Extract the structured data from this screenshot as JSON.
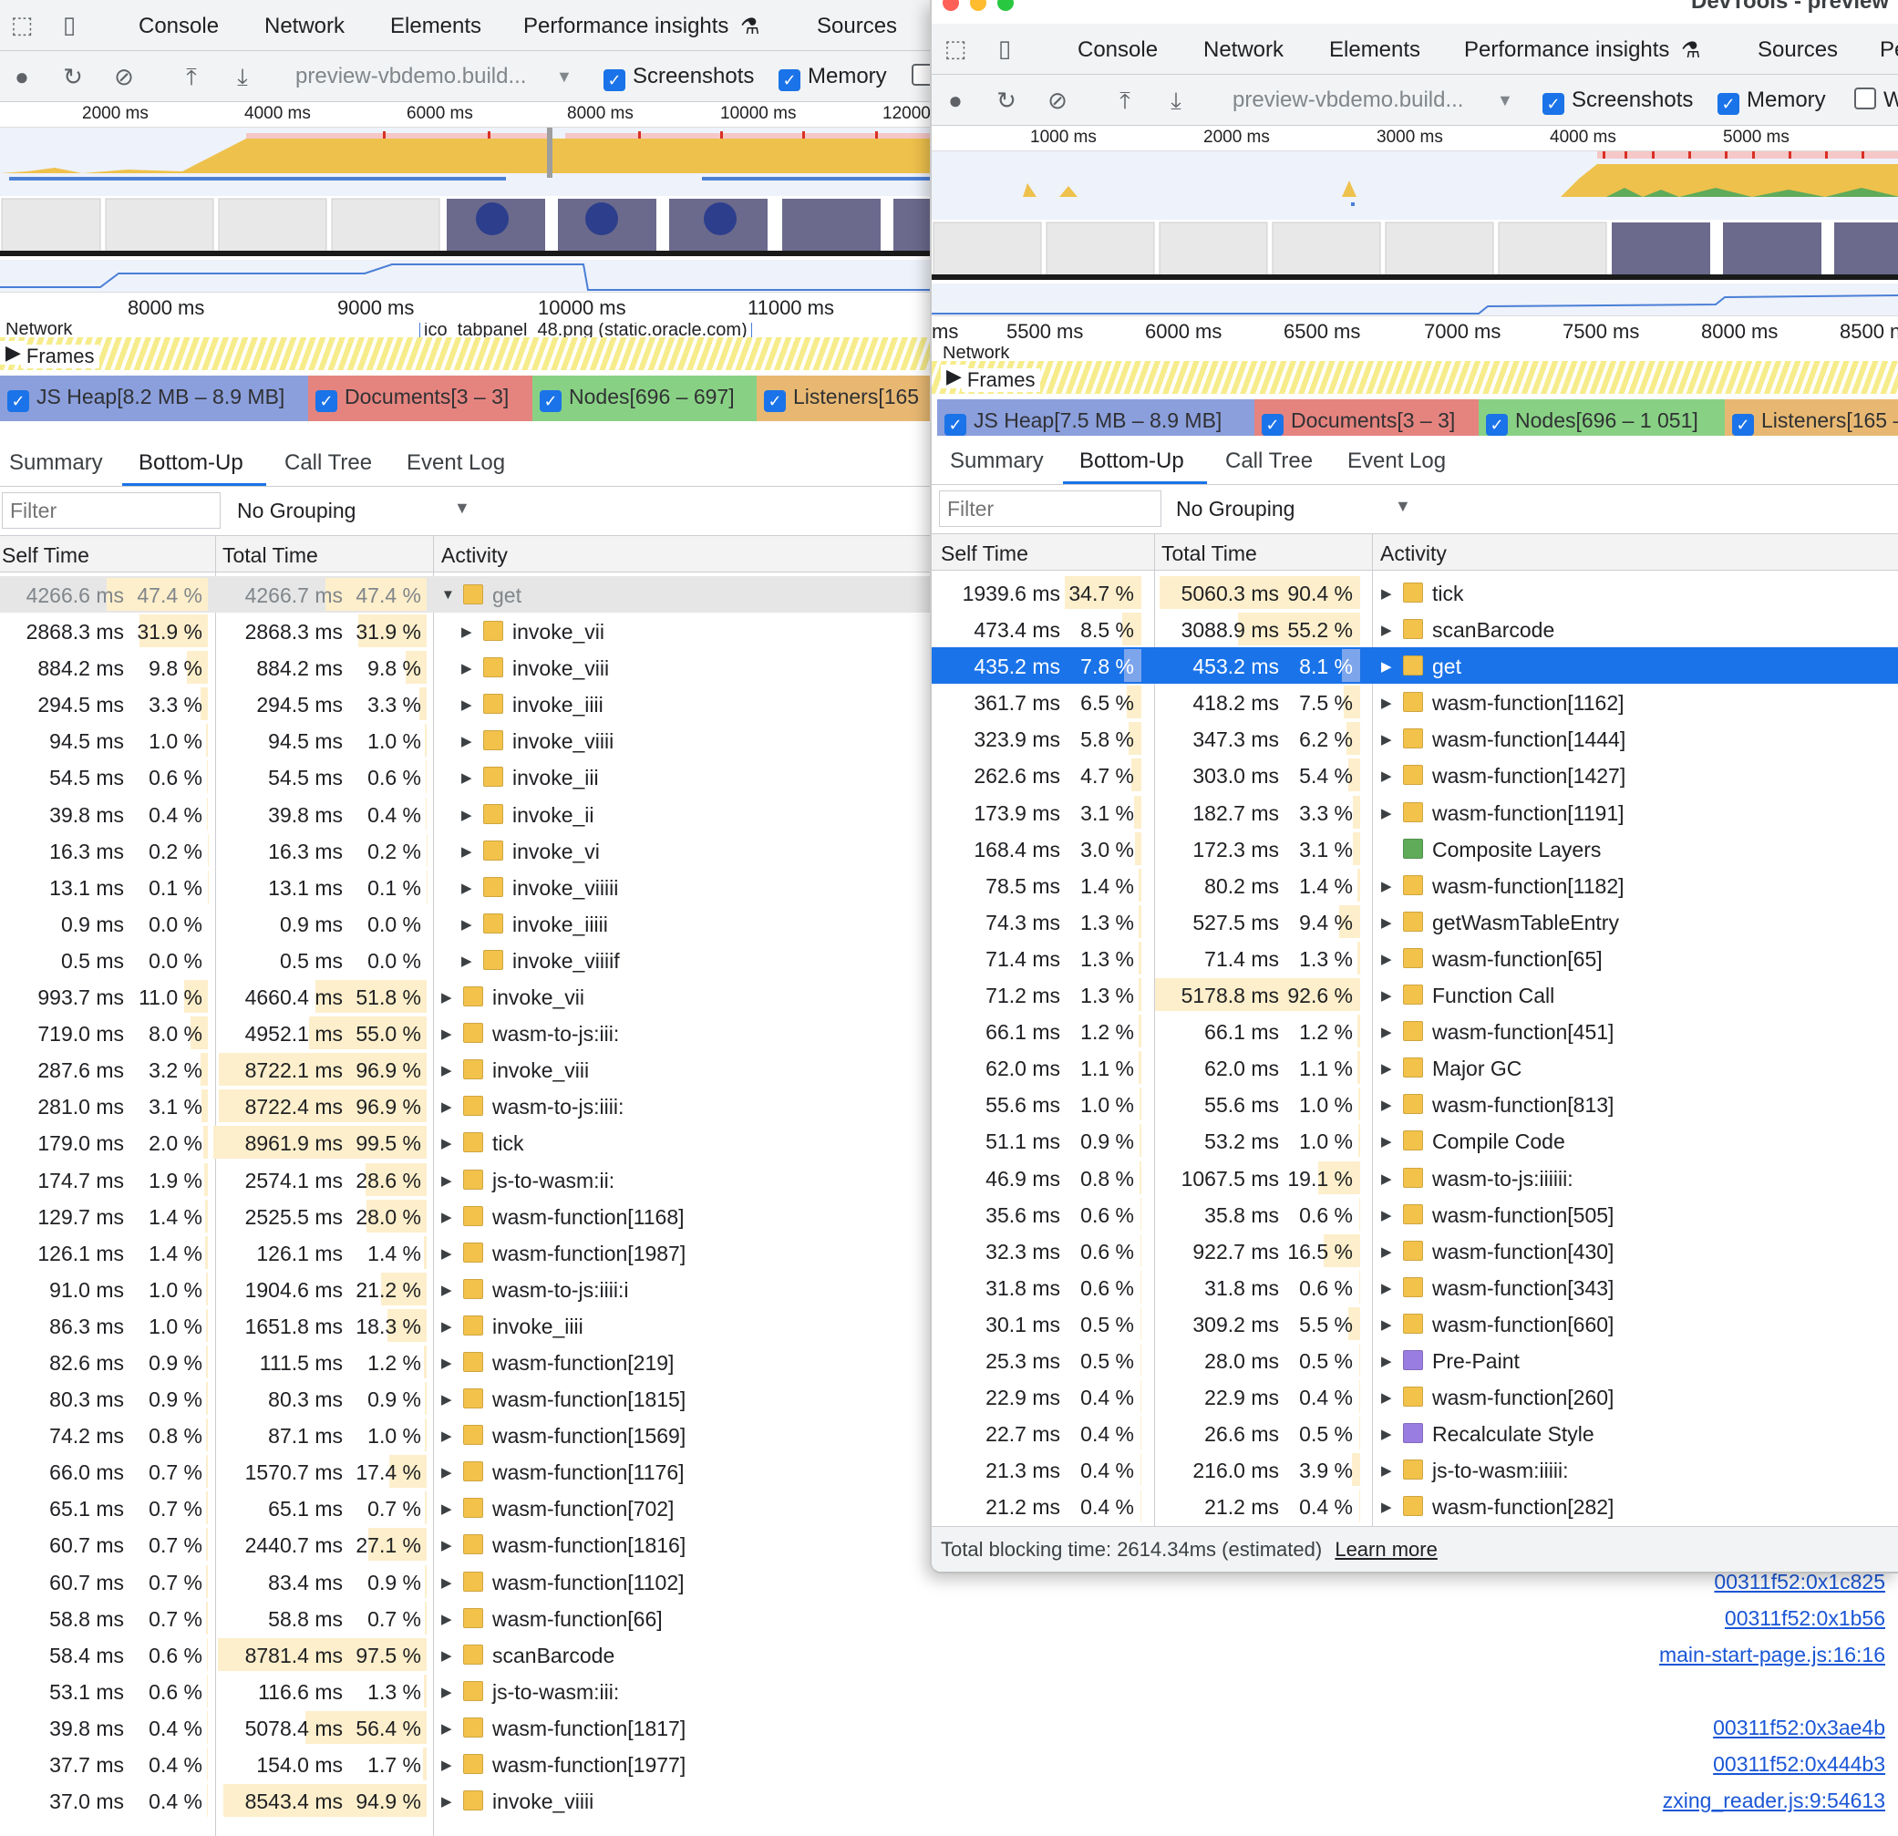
{
  "colors": {
    "accent": "#1a73e8",
    "bar": "#fdefcb",
    "js": "#f2c24b",
    "render": "#9a7de0",
    "paint": "#5fab5a"
  },
  "left": {
    "tabs": [
      "Console",
      "Network",
      "Elements",
      "Performance insights",
      "Sources"
    ],
    "toolbar": {
      "url": "preview-vbdemo.build...",
      "screenshots": "Screenshots",
      "memory": "Memory"
    },
    "ruler": [
      "2000 ms",
      "4000 ms",
      "6000 ms",
      "8000 ms",
      "10000 ms",
      "12000"
    ],
    "ruler2": [
      "8000 ms",
      "9000 ms",
      "10000 ms",
      "11000 ms"
    ],
    "network_label": "Network",
    "network_item": "ico_tabpanel_48.png (static.oracle.com)",
    "frames_label": "Frames",
    "counters": [
      "JS Heap[8.2 MB – 8.9 MB]",
      "Documents[3 – 3]",
      "Nodes[696 – 697]",
      "Listeners[165"
    ],
    "panel_tabs": [
      "Summary",
      "Bottom-Up",
      "Call Tree",
      "Event Log"
    ],
    "filter_placeholder": "Filter",
    "grouping": "No Grouping",
    "headers": {
      "self": "Self Time",
      "total": "Total Time",
      "activity": "Activity"
    },
    "rows": [
      {
        "self": "4266.6 ms",
        "selfp": "47.4 %",
        "sp": 47.4,
        "total": "4266.7 ms",
        "totalp": "47.4 %",
        "tp": 47.4,
        "name": "get",
        "depth": 0,
        "exp": "open",
        "color": "js",
        "hl": true
      },
      {
        "self": "2868.3 ms",
        "selfp": "31.9 %",
        "sp": 31.9,
        "total": "2868.3 ms",
        "totalp": "31.9 %",
        "tp": 31.9,
        "name": "invoke_vii",
        "depth": 1,
        "exp": "closed",
        "color": "js"
      },
      {
        "self": "884.2 ms",
        "selfp": "9.8 %",
        "sp": 9.8,
        "total": "884.2 ms",
        "totalp": "9.8 %",
        "tp": 9.8,
        "name": "invoke_viii",
        "depth": 1,
        "exp": "closed",
        "color": "js"
      },
      {
        "self": "294.5 ms",
        "selfp": "3.3 %",
        "sp": 3.3,
        "total": "294.5 ms",
        "totalp": "3.3 %",
        "tp": 3.3,
        "name": "invoke_iiii",
        "depth": 1,
        "exp": "closed",
        "color": "js"
      },
      {
        "self": "94.5 ms",
        "selfp": "1.0 %",
        "sp": 1.0,
        "total": "94.5 ms",
        "totalp": "1.0 %",
        "tp": 1.0,
        "name": "invoke_viiii",
        "depth": 1,
        "exp": "closed",
        "color": "js"
      },
      {
        "self": "54.5 ms",
        "selfp": "0.6 %",
        "sp": 0.6,
        "total": "54.5 ms",
        "totalp": "0.6 %",
        "tp": 0.6,
        "name": "invoke_iii",
        "depth": 1,
        "exp": "closed",
        "color": "js"
      },
      {
        "self": "39.8 ms",
        "selfp": "0.4 %",
        "sp": 0.4,
        "total": "39.8 ms",
        "totalp": "0.4 %",
        "tp": 0.4,
        "name": "invoke_ii",
        "depth": 1,
        "exp": "closed",
        "color": "js"
      },
      {
        "self": "16.3 ms",
        "selfp": "0.2 %",
        "sp": 0.2,
        "total": "16.3 ms",
        "totalp": "0.2 %",
        "tp": 0.2,
        "name": "invoke_vi",
        "depth": 1,
        "exp": "closed",
        "color": "js"
      },
      {
        "self": "13.1 ms",
        "selfp": "0.1 %",
        "sp": 0.1,
        "total": "13.1 ms",
        "totalp": "0.1 %",
        "tp": 0.1,
        "name": "invoke_viiiii",
        "depth": 1,
        "exp": "closed",
        "color": "js"
      },
      {
        "self": "0.9 ms",
        "selfp": "0.0 %",
        "sp": 0,
        "total": "0.9 ms",
        "totalp": "0.0 %",
        "tp": 0,
        "name": "invoke_iiiii",
        "depth": 1,
        "exp": "closed",
        "color": "js"
      },
      {
        "self": "0.5 ms",
        "selfp": "0.0 %",
        "sp": 0,
        "total": "0.5 ms",
        "totalp": "0.0 %",
        "tp": 0,
        "name": "invoke_viiiif",
        "depth": 1,
        "exp": "closed",
        "color": "js"
      },
      {
        "self": "993.7 ms",
        "selfp": "11.0 %",
        "sp": 11.0,
        "total": "4660.4 ms",
        "totalp": "51.8 %",
        "tp": 51.8,
        "name": "invoke_vii",
        "depth": 0,
        "exp": "closed",
        "color": "js"
      },
      {
        "self": "719.0 ms",
        "selfp": "8.0 %",
        "sp": 8.0,
        "total": "4952.1 ms",
        "totalp": "55.0 %",
        "tp": 55.0,
        "name": "wasm-to-js:iii:",
        "depth": 0,
        "exp": "closed",
        "color": "js"
      },
      {
        "self": "287.6 ms",
        "selfp": "3.2 %",
        "sp": 3.2,
        "total": "8722.1 ms",
        "totalp": "96.9 %",
        "tp": 96.9,
        "name": "invoke_viii",
        "depth": 0,
        "exp": "closed",
        "color": "js"
      },
      {
        "self": "281.0 ms",
        "selfp": "3.1 %",
        "sp": 3.1,
        "total": "8722.4 ms",
        "totalp": "96.9 %",
        "tp": 96.9,
        "name": "wasm-to-js:iiii:",
        "depth": 0,
        "exp": "closed",
        "color": "js"
      },
      {
        "self": "179.0 ms",
        "selfp": "2.0 %",
        "sp": 2.0,
        "total": "8961.9 ms",
        "totalp": "99.5 %",
        "tp": 99.5,
        "name": "tick",
        "depth": 0,
        "exp": "closed",
        "color": "js"
      },
      {
        "self": "174.7 ms",
        "selfp": "1.9 %",
        "sp": 1.9,
        "total": "2574.1 ms",
        "totalp": "28.6 %",
        "tp": 28.6,
        "name": "js-to-wasm:ii:",
        "depth": 0,
        "exp": "closed",
        "color": "js"
      },
      {
        "self": "129.7 ms",
        "selfp": "1.4 %",
        "sp": 1.4,
        "total": "2525.5 ms",
        "totalp": "28.0 %",
        "tp": 28.0,
        "name": "wasm-function[1168]",
        "depth": 0,
        "exp": "closed",
        "color": "js"
      },
      {
        "self": "126.1 ms",
        "selfp": "1.4 %",
        "sp": 1.4,
        "total": "126.1 ms",
        "totalp": "1.4 %",
        "tp": 1.4,
        "name": "wasm-function[1987]",
        "depth": 0,
        "exp": "closed",
        "color": "js"
      },
      {
        "self": "91.0 ms",
        "selfp": "1.0 %",
        "sp": 1.0,
        "total": "1904.6 ms",
        "totalp": "21.2 %",
        "tp": 21.2,
        "name": "wasm-to-js:iiii:i",
        "depth": 0,
        "exp": "closed",
        "color": "js"
      },
      {
        "self": "86.3 ms",
        "selfp": "1.0 %",
        "sp": 1.0,
        "total": "1651.8 ms",
        "totalp": "18.3 %",
        "tp": 18.3,
        "name": "invoke_iiii",
        "depth": 0,
        "exp": "closed",
        "color": "js"
      },
      {
        "self": "82.6 ms",
        "selfp": "0.9 %",
        "sp": 0.9,
        "total": "111.5 ms",
        "totalp": "1.2 %",
        "tp": 1.2,
        "name": "wasm-function[219]",
        "depth": 0,
        "exp": "closed",
        "color": "js"
      },
      {
        "self": "80.3 ms",
        "selfp": "0.9 %",
        "sp": 0.9,
        "total": "80.3 ms",
        "totalp": "0.9 %",
        "tp": 0.9,
        "name": "wasm-function[1815]",
        "depth": 0,
        "exp": "closed",
        "color": "js"
      },
      {
        "self": "74.2 ms",
        "selfp": "0.8 %",
        "sp": 0.8,
        "total": "87.1 ms",
        "totalp": "1.0 %",
        "tp": 1.0,
        "name": "wasm-function[1569]",
        "depth": 0,
        "exp": "closed",
        "color": "js"
      },
      {
        "self": "66.0 ms",
        "selfp": "0.7 %",
        "sp": 0.7,
        "total": "1570.7 ms",
        "totalp": "17.4 %",
        "tp": 17.4,
        "name": "wasm-function[1176]",
        "depth": 0,
        "exp": "closed",
        "color": "js"
      },
      {
        "self": "65.1 ms",
        "selfp": "0.7 %",
        "sp": 0.7,
        "total": "65.1 ms",
        "totalp": "0.7 %",
        "tp": 0.7,
        "name": "wasm-function[702]",
        "depth": 0,
        "exp": "closed",
        "color": "js"
      },
      {
        "self": "60.7 ms",
        "selfp": "0.7 %",
        "sp": 0.7,
        "total": "2440.7 ms",
        "totalp": "27.1 %",
        "tp": 27.1,
        "name": "wasm-function[1816]",
        "depth": 0,
        "exp": "closed",
        "color": "js"
      },
      {
        "self": "60.7 ms",
        "selfp": "0.7 %",
        "sp": 0.7,
        "total": "83.4 ms",
        "totalp": "0.9 %",
        "tp": 0.9,
        "name": "wasm-function[1102]",
        "depth": 0,
        "exp": "closed",
        "color": "js"
      },
      {
        "self": "58.8 ms",
        "selfp": "0.7 %",
        "sp": 0.7,
        "total": "58.8 ms",
        "totalp": "0.7 %",
        "tp": 0.7,
        "name": "wasm-function[66]",
        "depth": 0,
        "exp": "closed",
        "color": "js"
      },
      {
        "self": "58.4 ms",
        "selfp": "0.6 %",
        "sp": 0.6,
        "total": "8781.4 ms",
        "totalp": "97.5 %",
        "tp": 97.5,
        "name": "scanBarcode",
        "depth": 0,
        "exp": "closed",
        "color": "js"
      },
      {
        "self": "53.1 ms",
        "selfp": "0.6 %",
        "sp": 0.6,
        "total": "116.6 ms",
        "totalp": "1.3 %",
        "tp": 1.3,
        "name": "js-to-wasm:iii:",
        "depth": 0,
        "exp": "closed",
        "color": "js"
      },
      {
        "self": "39.8 ms",
        "selfp": "0.4 %",
        "sp": 0.4,
        "total": "5078.4 ms",
        "totalp": "56.4 %",
        "tp": 56.4,
        "name": "wasm-function[1817]",
        "depth": 0,
        "exp": "closed",
        "color": "js"
      },
      {
        "self": "37.7 ms",
        "selfp": "0.4 %",
        "sp": 0.4,
        "total": "154.0 ms",
        "totalp": "1.7 %",
        "tp": 1.7,
        "name": "wasm-function[1977]",
        "depth": 0,
        "exp": "closed",
        "color": "js"
      },
      {
        "self": "37.0 ms",
        "selfp": "0.4 %",
        "sp": 0.4,
        "total": "8543.4 ms",
        "totalp": "94.9 %",
        "tp": 94.9,
        "name": "invoke_viiii",
        "depth": 0,
        "exp": "closed",
        "color": "js"
      }
    ],
    "source_links": [
      "00311f52:0x1c825",
      "00311f52:0x1b56",
      "main-start-page.js:16:16",
      "",
      "00311f52:0x3ae4b",
      "00311f52:0x444b3",
      "zxing_reader.js:9:54613"
    ]
  },
  "right": {
    "title": "DevTools - preview",
    "tabs": [
      "Console",
      "Network",
      "Elements",
      "Performance insights",
      "Sources",
      "Pe"
    ],
    "toolbar": {
      "url": "preview-vbdemo.build...",
      "screenshots": "Screenshots",
      "memory": "Memory",
      "w": "W"
    },
    "ruler": [
      "1000 ms",
      "2000 ms",
      "3000 ms",
      "4000 ms",
      "5000 ms"
    ],
    "ruler2": [
      "ms",
      "5500 ms",
      "6000 ms",
      "6500 ms",
      "7000 ms",
      "7500 ms",
      "8000 ms",
      "8500 n"
    ],
    "network_label": "Network",
    "frames_label": "Frames",
    "counters": [
      "JS Heap[7.5 MB – 8.9 MB]",
      "Documents[3 – 3]",
      "Nodes[696 – 1 051]",
      "Listeners[165 –"
    ],
    "panel_tabs": [
      "Summary",
      "Bottom-Up",
      "Call Tree",
      "Event Log"
    ],
    "filter_placeholder": "Filter",
    "grouping": "No Grouping",
    "headers": {
      "self": "Self Time",
      "total": "Total Time",
      "activity": "Activity"
    },
    "rows": [
      {
        "self": "1939.6 ms",
        "selfp": "34.7 %",
        "sp": 34.7,
        "total": "5060.3 ms",
        "totalp": "90.4 %",
        "tp": 90.4,
        "name": "tick",
        "exp": "closed",
        "color": "js"
      },
      {
        "self": "473.4 ms",
        "selfp": "8.5 %",
        "sp": 8.5,
        "total": "3088.9 ms",
        "totalp": "55.2 %",
        "tp": 55.2,
        "name": "scanBarcode",
        "exp": "closed",
        "color": "js"
      },
      {
        "self": "435.2 ms",
        "selfp": "7.8 %",
        "sp": 7.8,
        "total": "453.2 ms",
        "totalp": "8.1 %",
        "tp": 8.1,
        "name": "get",
        "exp": "closed",
        "color": "js",
        "sel": true
      },
      {
        "self": "361.7 ms",
        "selfp": "6.5 %",
        "sp": 6.5,
        "total": "418.2 ms",
        "totalp": "7.5 %",
        "tp": 7.5,
        "name": "wasm-function[1162]",
        "exp": "closed",
        "color": "js"
      },
      {
        "self": "323.9 ms",
        "selfp": "5.8 %",
        "sp": 5.8,
        "total": "347.3 ms",
        "totalp": "6.2 %",
        "tp": 6.2,
        "name": "wasm-function[1444]",
        "exp": "closed",
        "color": "js"
      },
      {
        "self": "262.6 ms",
        "selfp": "4.7 %",
        "sp": 4.7,
        "total": "303.0 ms",
        "totalp": "5.4 %",
        "tp": 5.4,
        "name": "wasm-function[1427]",
        "exp": "closed",
        "color": "js"
      },
      {
        "self": "173.9 ms",
        "selfp": "3.1 %",
        "sp": 3.1,
        "total": "182.7 ms",
        "totalp": "3.3 %",
        "tp": 3.3,
        "name": "wasm-function[1191]",
        "exp": "closed",
        "color": "js"
      },
      {
        "self": "168.4 ms",
        "selfp": "3.0 %",
        "sp": 3.0,
        "total": "172.3 ms",
        "totalp": "3.1 %",
        "tp": 3.1,
        "name": "Composite Layers",
        "exp": "none",
        "color": "paint"
      },
      {
        "self": "78.5 ms",
        "selfp": "1.4 %",
        "sp": 1.4,
        "total": "80.2 ms",
        "totalp": "1.4 %",
        "tp": 1.4,
        "name": "wasm-function[1182]",
        "exp": "closed",
        "color": "js"
      },
      {
        "self": "74.3 ms",
        "selfp": "1.3 %",
        "sp": 1.3,
        "total": "527.5 ms",
        "totalp": "9.4 %",
        "tp": 9.4,
        "name": "getWasmTableEntry",
        "exp": "closed",
        "color": "js"
      },
      {
        "self": "71.4 ms",
        "selfp": "1.3 %",
        "sp": 1.3,
        "total": "71.4 ms",
        "totalp": "1.3 %",
        "tp": 1.3,
        "name": "wasm-function[65]",
        "exp": "closed",
        "color": "js"
      },
      {
        "self": "71.2 ms",
        "selfp": "1.3 %",
        "sp": 1.3,
        "total": "5178.8 ms",
        "totalp": "92.6 %",
        "tp": 92.6,
        "name": "Function Call",
        "exp": "closed",
        "color": "js"
      },
      {
        "self": "66.1 ms",
        "selfp": "1.2 %",
        "sp": 1.2,
        "total": "66.1 ms",
        "totalp": "1.2 %",
        "tp": 1.2,
        "name": "wasm-function[451]",
        "exp": "closed",
        "color": "js"
      },
      {
        "self": "62.0 ms",
        "selfp": "1.1 %",
        "sp": 1.1,
        "total": "62.0 ms",
        "totalp": "1.1 %",
        "tp": 1.1,
        "name": "Major GC",
        "exp": "closed",
        "color": "js"
      },
      {
        "self": "55.6 ms",
        "selfp": "1.0 %",
        "sp": 1.0,
        "total": "55.6 ms",
        "totalp": "1.0 %",
        "tp": 1.0,
        "name": "wasm-function[813]",
        "exp": "closed",
        "color": "js"
      },
      {
        "self": "51.1 ms",
        "selfp": "0.9 %",
        "sp": 0.9,
        "total": "53.2 ms",
        "totalp": "1.0 %",
        "tp": 1.0,
        "name": "Compile Code",
        "exp": "closed",
        "color": "js"
      },
      {
        "self": "46.9 ms",
        "selfp": "0.8 %",
        "sp": 0.8,
        "total": "1067.5 ms",
        "totalp": "19.1 %",
        "tp": 19.1,
        "name": "wasm-to-js:iiiiii:",
        "exp": "closed",
        "color": "js"
      },
      {
        "self": "35.6 ms",
        "selfp": "0.6 %",
        "sp": 0.6,
        "total": "35.8 ms",
        "totalp": "0.6 %",
        "tp": 0.6,
        "name": "wasm-function[505]",
        "exp": "closed",
        "color": "js"
      },
      {
        "self": "32.3 ms",
        "selfp": "0.6 %",
        "sp": 0.6,
        "total": "922.7 ms",
        "totalp": "16.5 %",
        "tp": 16.5,
        "name": "wasm-function[430]",
        "exp": "closed",
        "color": "js"
      },
      {
        "self": "31.8 ms",
        "selfp": "0.6 %",
        "sp": 0.6,
        "total": "31.8 ms",
        "totalp": "0.6 %",
        "tp": 0.6,
        "name": "wasm-function[343]",
        "exp": "closed",
        "color": "js"
      },
      {
        "self": "30.1 ms",
        "selfp": "0.5 %",
        "sp": 0.5,
        "total": "309.2 ms",
        "totalp": "5.5 %",
        "tp": 5.5,
        "name": "wasm-function[660]",
        "exp": "closed",
        "color": "js"
      },
      {
        "self": "25.3 ms",
        "selfp": "0.5 %",
        "sp": 0.5,
        "total": "28.0 ms",
        "totalp": "0.5 %",
        "tp": 0.5,
        "name": "Pre-Paint",
        "exp": "closed",
        "color": "render"
      },
      {
        "self": "22.9 ms",
        "selfp": "0.4 %",
        "sp": 0.4,
        "total": "22.9 ms",
        "totalp": "0.4 %",
        "tp": 0.4,
        "name": "wasm-function[260]",
        "exp": "closed",
        "color": "js"
      },
      {
        "self": "22.7 ms",
        "selfp": "0.4 %",
        "sp": 0.4,
        "total": "26.6 ms",
        "totalp": "0.5 %",
        "tp": 0.5,
        "name": "Recalculate Style",
        "exp": "closed",
        "color": "render"
      },
      {
        "self": "21.3 ms",
        "selfp": "0.4 %",
        "sp": 0.4,
        "total": "216.0 ms",
        "totalp": "3.9 %",
        "tp": 3.9,
        "name": "js-to-wasm:iiiii:",
        "exp": "closed",
        "color": "js"
      },
      {
        "self": "21.2 ms",
        "selfp": "0.4 %",
        "sp": 0.4,
        "total": "21.2 ms",
        "totalp": "0.4 %",
        "tp": 0.4,
        "name": "wasm-function[282]",
        "exp": "closed",
        "color": "js"
      }
    ],
    "footer": {
      "text": "Total blocking time: 2614.34ms (estimated)",
      "link": "Learn more"
    }
  }
}
